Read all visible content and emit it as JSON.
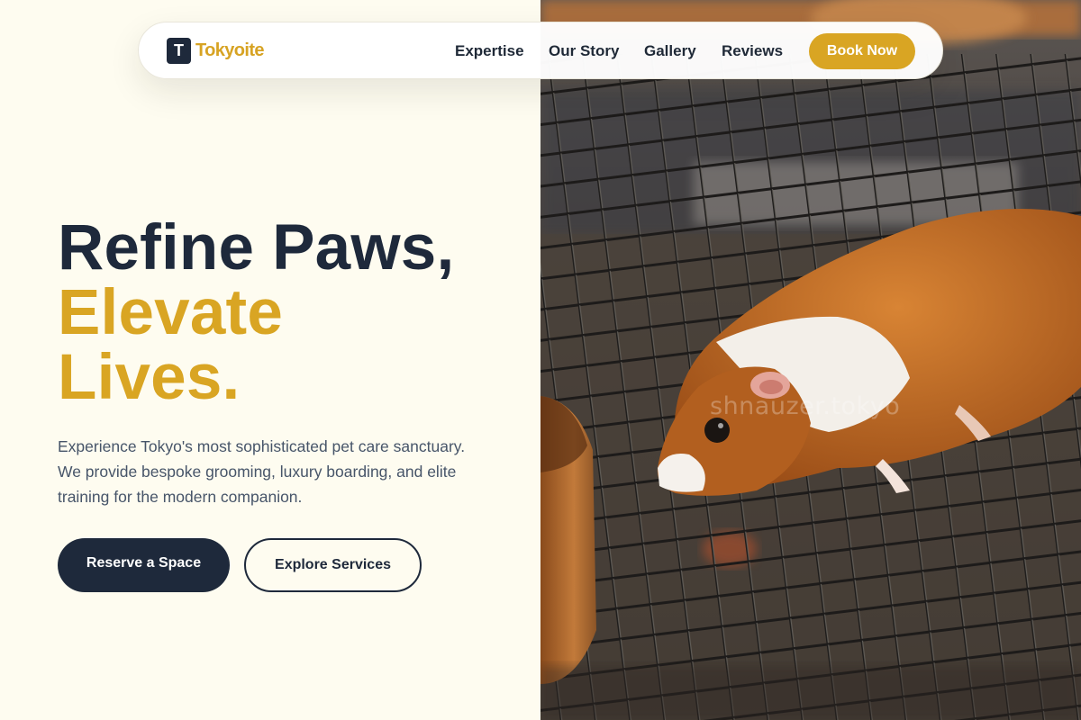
{
  "brand": {
    "logo_letter": "T",
    "name": "Tokyoite"
  },
  "nav": {
    "links": [
      "Expertise",
      "Our Story",
      "Gallery",
      "Reviews"
    ],
    "cta": "Book Now"
  },
  "hero": {
    "headline_line1": "Refine Paws,",
    "headline_line2": "Elevate",
    "headline_line3": "Lives.",
    "description": "Experience Tokyo's most sophisticated pet care sanctuary. We provide bespoke grooming, luxury boarding, and elite training for the modern companion.",
    "primary_button": "Reserve a Space",
    "secondary_button": "Explore Services",
    "image_alt": "Guinea pig on a metal cage grate",
    "watermark": "shnauzer.tokyo"
  },
  "colors": {
    "background": "#fefcf0",
    "navy": "#1e293b",
    "gold": "#d9a523",
    "body_text": "#475569"
  }
}
